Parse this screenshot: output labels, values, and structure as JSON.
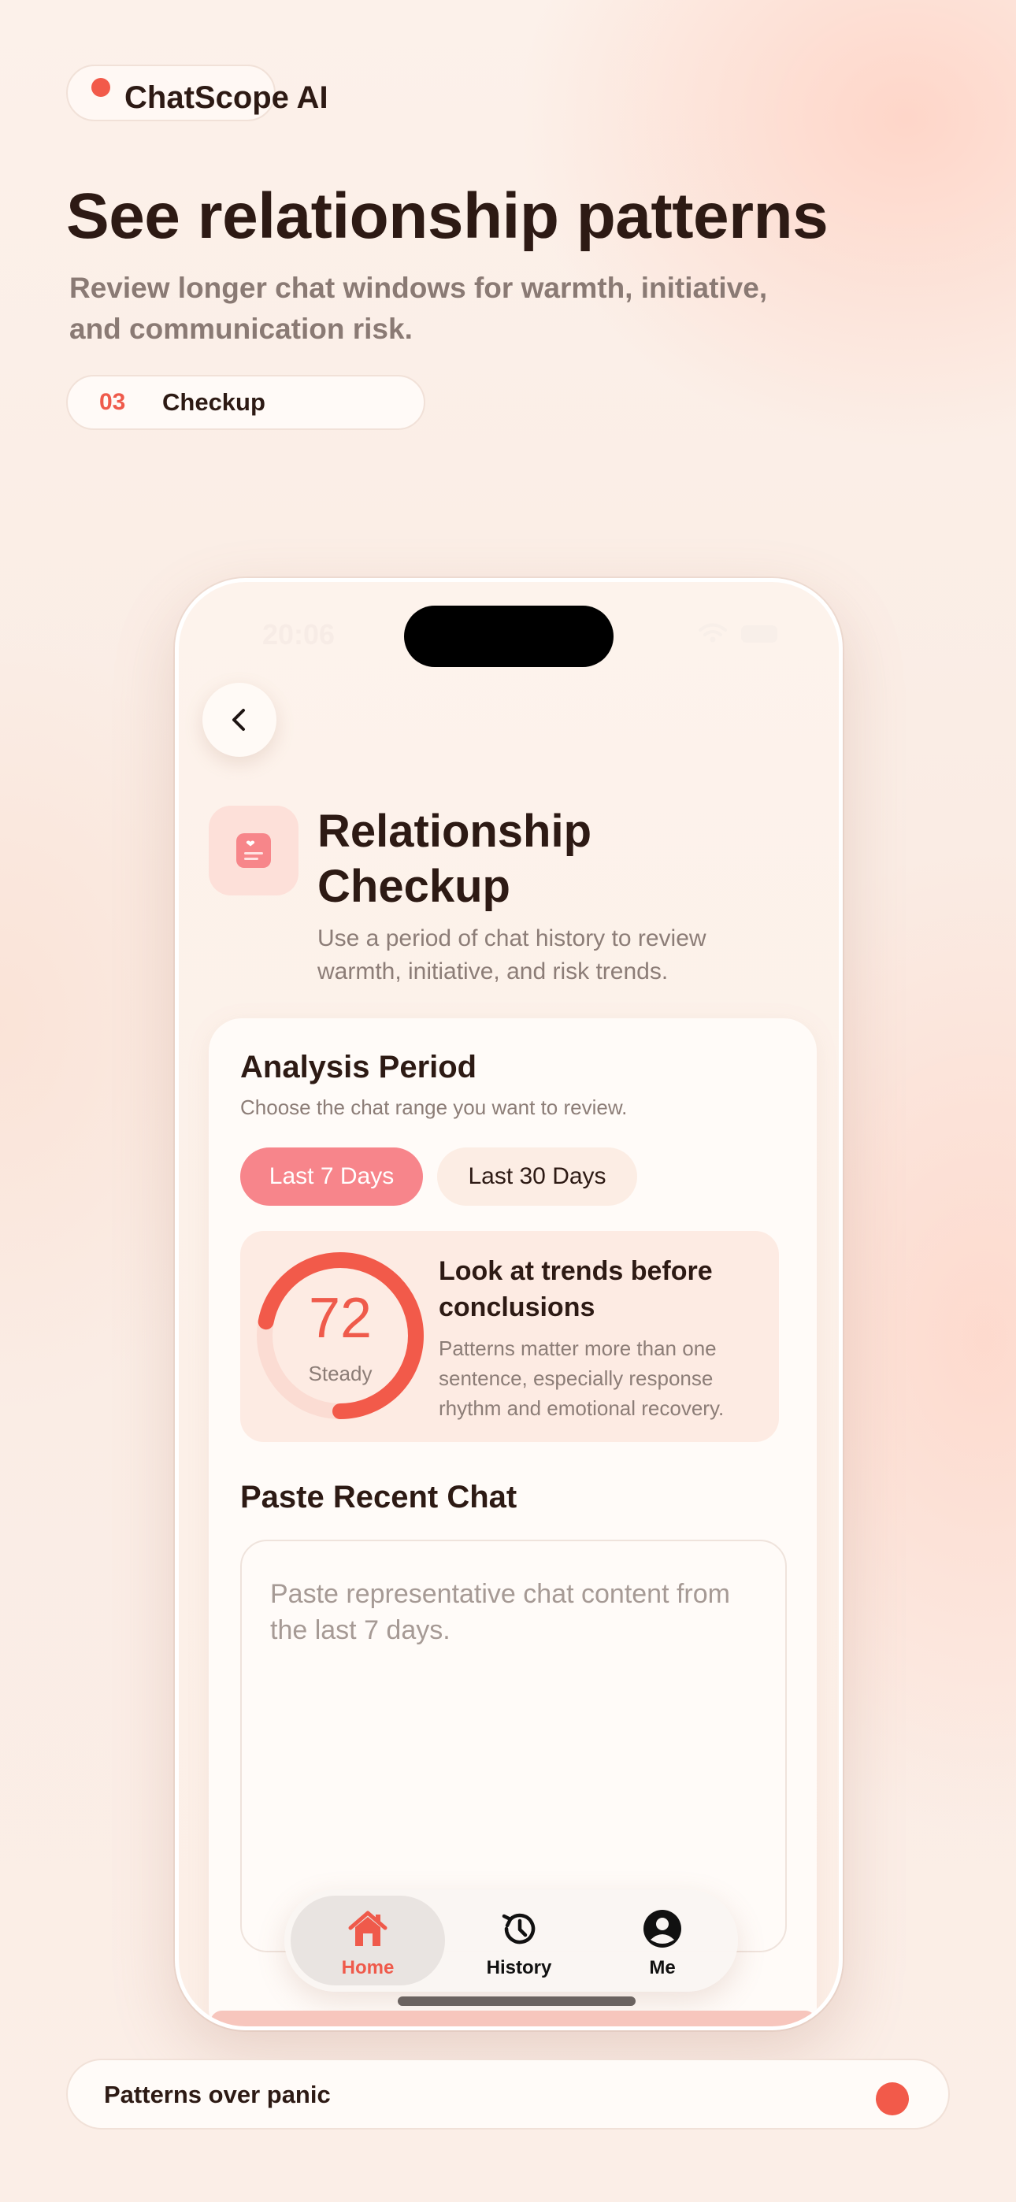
{
  "brand": {
    "name": "ChatScope AI",
    "accent": "#f25a4a"
  },
  "hero": {
    "title": "See relationship patterns",
    "subtitle": "Review longer chat windows for warmth, initiative, and communication risk."
  },
  "step": {
    "number": "03",
    "label": "Checkup"
  },
  "phone": {
    "status_time": "20:06",
    "back_icon": "chevron-left-icon",
    "header": {
      "icon": "journal-heart-icon",
      "title": "Relationship Checkup",
      "subtitle": "Use a period of chat history to review warmth, initiative, and risk trends."
    },
    "period": {
      "title": "Analysis Period",
      "subtitle": "Choose the chat range you want to review.",
      "options": [
        "Last 7 Days",
        "Last 30 Days"
      ],
      "selected": "Last 7 Days"
    },
    "insight": {
      "score": "72",
      "score_fraction": 0.72,
      "score_label": "Steady",
      "title": "Look at trends before conclusions",
      "body": "Patterns matter more than one sentence, especially response rhythm and emotional recovery."
    },
    "paste": {
      "title": "Paste Recent Chat",
      "placeholder": "Paste representative chat content from the last 7 days."
    },
    "tabs": [
      {
        "label": "Home",
        "icon": "home-icon",
        "active": true
      },
      {
        "label": "History",
        "icon": "history-icon",
        "active": false
      },
      {
        "label": "Me",
        "icon": "user-icon",
        "active": false
      }
    ]
  },
  "footer": {
    "text": "Patterns over panic"
  },
  "colors": {
    "accent": "#ef5a4b",
    "pink": "#f7858b",
    "text": "#2d1a14",
    "muted": "#8c7d77"
  }
}
